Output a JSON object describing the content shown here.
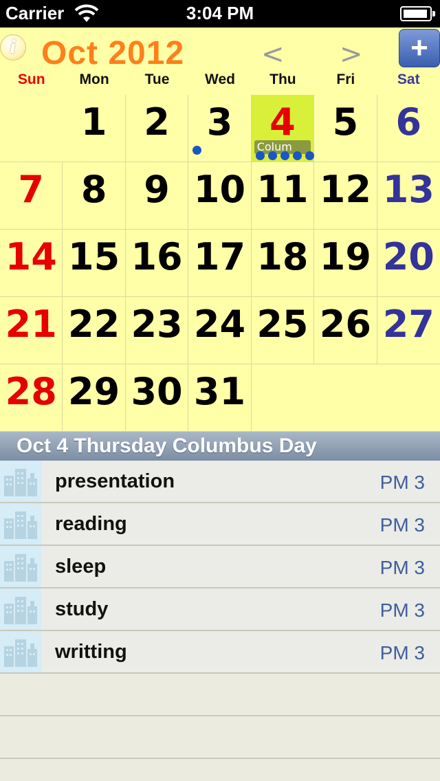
{
  "status_bar": {
    "carrier": "Carrier",
    "time": "3:04 PM"
  },
  "header": {
    "info_label": "i",
    "month_title": "Oct 2012",
    "prev_label": "<",
    "next_label": ">",
    "add_label": "+"
  },
  "weekdays": [
    "Sun",
    "Mon",
    "Tue",
    "Wed",
    "Thu",
    "Fri",
    "Sat"
  ],
  "days": [
    {
      "label": "",
      "type": "empty"
    },
    {
      "label": "1",
      "type": "weekday"
    },
    {
      "label": "2",
      "type": "weekday"
    },
    {
      "label": "3",
      "type": "weekday",
      "dots": 1
    },
    {
      "label": "4",
      "type": "today",
      "event": "Colum",
      "dots": 5
    },
    {
      "label": "5",
      "type": "weekday"
    },
    {
      "label": "6",
      "type": "sat"
    },
    {
      "label": "7",
      "type": "sun"
    },
    {
      "label": "8",
      "type": "weekday"
    },
    {
      "label": "9",
      "type": "weekday"
    },
    {
      "label": "10",
      "type": "weekday"
    },
    {
      "label": "11",
      "type": "weekday"
    },
    {
      "label": "12",
      "type": "weekday"
    },
    {
      "label": "13",
      "type": "sat"
    },
    {
      "label": "14",
      "type": "sun"
    },
    {
      "label": "15",
      "type": "weekday"
    },
    {
      "label": "16",
      "type": "weekday"
    },
    {
      "label": "17",
      "type": "weekday"
    },
    {
      "label": "18",
      "type": "weekday"
    },
    {
      "label": "19",
      "type": "weekday"
    },
    {
      "label": "20",
      "type": "sat"
    },
    {
      "label": "21",
      "type": "sun"
    },
    {
      "label": "22",
      "type": "weekday"
    },
    {
      "label": "23",
      "type": "weekday"
    },
    {
      "label": "24",
      "type": "weekday"
    },
    {
      "label": "25",
      "type": "weekday"
    },
    {
      "label": "26",
      "type": "weekday"
    },
    {
      "label": "27",
      "type": "sat"
    },
    {
      "label": "28",
      "type": "sun"
    },
    {
      "label": "29",
      "type": "weekday"
    },
    {
      "label": "30",
      "type": "weekday"
    },
    {
      "label": "31",
      "type": "weekday"
    },
    {
      "label": "",
      "type": "empty"
    },
    {
      "label": "",
      "type": "empty"
    },
    {
      "label": "",
      "type": "empty"
    }
  ],
  "selected_day_header": "Oct 4 Thursday Columbus Day",
  "events": [
    {
      "title": "presentation",
      "time": "PM 3",
      "icon": "building-icon"
    },
    {
      "title": "reading",
      "time": "PM 3",
      "icon": "building-icon"
    },
    {
      "title": "sleep",
      "time": "PM 3",
      "icon": "building-icon"
    },
    {
      "title": "study",
      "time": "PM 3",
      "icon": "building-icon"
    },
    {
      "title": "writting",
      "time": "PM 3",
      "icon": "building-icon"
    }
  ],
  "colors": {
    "calendar_bg": "#ffffa8",
    "month_title": "#ff7f1a",
    "sunday": "#e60000",
    "saturday": "#33339a",
    "today_bg": "#d8f03a",
    "event_time": "#3f5f9c"
  }
}
